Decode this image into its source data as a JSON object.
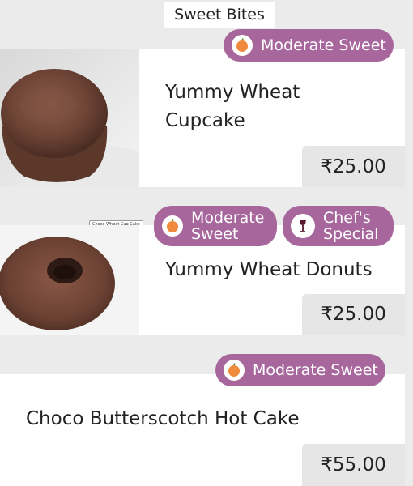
{
  "section": {
    "title": "Sweet Bites"
  },
  "items": [
    {
      "name": "Yummy Wheat Cupcake",
      "price": "₹25.00",
      "image_label": "Choco Wheat Cup Cake",
      "badges": [
        {
          "text": "Moderate Sweet",
          "icon": "apple-icon"
        }
      ]
    },
    {
      "name": "Yummy Wheat Donuts",
      "price": "₹25.00",
      "badges": [
        {
          "text": "Moderate Sweet",
          "icon": "apple-icon"
        },
        {
          "text": "Chef's Special",
          "icon": "wine-glass-icon"
        }
      ]
    },
    {
      "name": "Choco Butterscotch Hot Cake",
      "price": "₹55.00",
      "badges": [
        {
          "text": "Moderate Sweet",
          "icon": "apple-icon"
        }
      ]
    }
  ],
  "colors": {
    "badge": "#a7679c",
    "background": "#ebebeb",
    "price_bg": "#e6e6e6"
  }
}
